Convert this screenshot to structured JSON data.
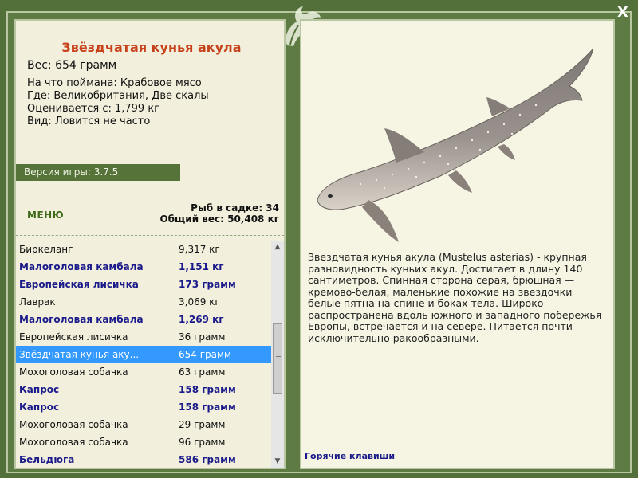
{
  "fish": {
    "title": "Звёздчатая кунья акула",
    "weight": "Вес: 654 грамм",
    "bait": "На что поймана: Крабовое мясо",
    "location": "Где: Великобритания, Две скалы",
    "value": "Оценивается с: 1,799 кг",
    "rarity": "Вид: Ловится не часто"
  },
  "version": "Версия игры: 3.7.5",
  "menu_label": "МЕНЮ",
  "stats": {
    "fish_count": "Рыб в садке: 34",
    "total_weight": "Общий вес: 50,408 кг"
  },
  "catch_list": [
    {
      "name": "Биркеланг",
      "weight": "9,317 кг",
      "bold": false,
      "selected": false
    },
    {
      "name": "Малоголовая камбала",
      "weight": "1,151 кг",
      "bold": true,
      "selected": false
    },
    {
      "name": "Европейская лисичка",
      "weight": "173 грамм",
      "bold": true,
      "selected": false
    },
    {
      "name": "Лаврак",
      "weight": "3,069 кг",
      "bold": false,
      "selected": false
    },
    {
      "name": "Малоголовая камбала",
      "weight": "1,269 кг",
      "bold": true,
      "selected": false
    },
    {
      "name": "Европейская лисичка",
      "weight": "36 грамм",
      "bold": false,
      "selected": false
    },
    {
      "name": "Звёздчатая кунья аку...",
      "weight": "654 грамм",
      "bold": false,
      "selected": true
    },
    {
      "name": "Мохоголовая собачка",
      "weight": "63 грамм",
      "bold": false,
      "selected": false
    },
    {
      "name": "Капрос",
      "weight": "158 грамм",
      "bold": true,
      "selected": false
    },
    {
      "name": "Капрос",
      "weight": "158 грамм",
      "bold": true,
      "selected": false
    },
    {
      "name": "Мохоголовая собачка",
      "weight": "29 грамм",
      "bold": false,
      "selected": false
    },
    {
      "name": "Мохоголовая собачка",
      "weight": "96 грамм",
      "bold": false,
      "selected": false
    },
    {
      "name": "Бельдюга",
      "weight": "586 грамм",
      "bold": true,
      "selected": false
    }
  ],
  "description": "Звездчатая кунья акула (Mustelus asterias) - крупная разновидность куньих акул. Достигает в длину 140 сантиметров. Спинная сторона серая, брюшная — кремово-белая, маленькие похожие на звездочки белые пятна на спине и боках тела. Широко распространена вдоль южного и западного побережья Европы, встречается и на севере. Питается почти исключительно ракообразными.",
  "hotkeys_label": "Горячие клавиши",
  "close_label": "X",
  "colors": {
    "frame": "#54703a",
    "panel": "#f2f0dc",
    "title": "#c7411b",
    "link": "#1a1a8a",
    "selection": "#3399ff"
  },
  "icons": [
    "close-icon",
    "dragon-logo-icon",
    "scroll-up-icon",
    "scroll-down-icon"
  ]
}
